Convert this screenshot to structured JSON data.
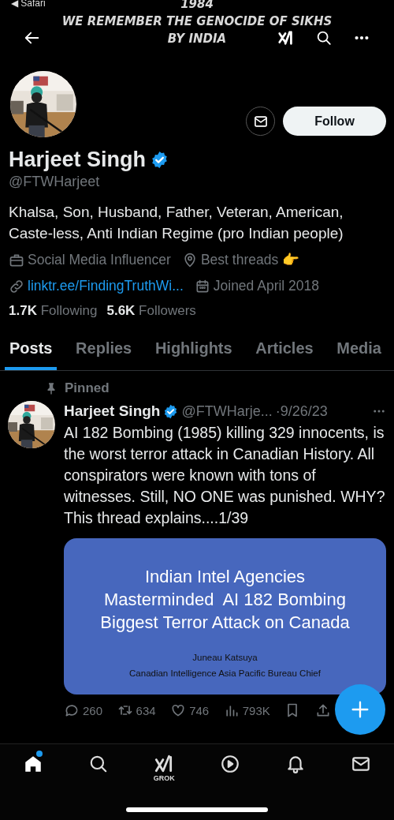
{
  "status_bar": {
    "back_label": "◀ Safari"
  },
  "banner": {
    "lines": [
      "1984",
      "WE REMEMBER THE GENOCIDE OF SIKHS",
      "BY INDIA"
    ]
  },
  "profile": {
    "name": "Harjeet Singh",
    "verified": true,
    "handle": "@FTWHarjeet",
    "follow_label": "Follow",
    "bio": "Khalsa, Son, Husband, Father, Veteran, American, Caste-less, Anti Indian Regime (pro Indian people)",
    "meta": [
      {
        "kind": "category",
        "text": "Social Media Influencer"
      },
      {
        "kind": "location",
        "text": "Best threads 👉"
      },
      {
        "kind": "link",
        "text": "linktr.ee/FindingTruthWi..."
      },
      {
        "kind": "joined",
        "text": "Joined April 2018"
      }
    ],
    "stats": [
      {
        "count": "1.7K",
        "label": "Following"
      },
      {
        "count": "5.6K",
        "label": "Followers"
      }
    ]
  },
  "tabs": [
    {
      "label": "Posts",
      "selected": true
    },
    {
      "label": "Replies",
      "selected": false
    },
    {
      "label": "Highlights",
      "selected": false
    },
    {
      "label": "Articles",
      "selected": false
    },
    {
      "label": "Media",
      "selected": false
    }
  ],
  "post": {
    "pinned_label": "Pinned",
    "name": "Harjeet Singh",
    "verified": true,
    "handle": "@FTWHarje...",
    "date": "·9/26/23",
    "text": "AI 182 Bombing (1985) killing 329 innocents, is the worst terror attack in Canadian History. All conspirators were known with tons of witnesses. Still, NO ONE was punished. WHY? This thread explains....1/39",
    "card": {
      "title_lines": [
        "Indian Intel Agencies",
        "Masterminded  AI 182 Bombing",
        "Biggest Terror Attack on Canada"
      ],
      "author": "Juneau Katsuya",
      "author_title": "Canadian Intelligence Asia Pacific Bureau Chief"
    },
    "actions": [
      {
        "kind": "reply",
        "count": "260"
      },
      {
        "kind": "repost",
        "count": "634"
      },
      {
        "kind": "like",
        "count": "746"
      },
      {
        "kind": "views",
        "count": "793K"
      },
      {
        "kind": "bookmark"
      },
      {
        "kind": "share"
      }
    ]
  },
  "bottom_nav": [
    {
      "kind": "home",
      "selected": true,
      "badge": true
    },
    {
      "kind": "search",
      "selected": false
    },
    {
      "kind": "grok",
      "label": "GROK",
      "selected": false
    },
    {
      "kind": "video",
      "selected": false
    },
    {
      "kind": "notifications",
      "selected": false
    },
    {
      "kind": "messages",
      "selected": false
    }
  ]
}
